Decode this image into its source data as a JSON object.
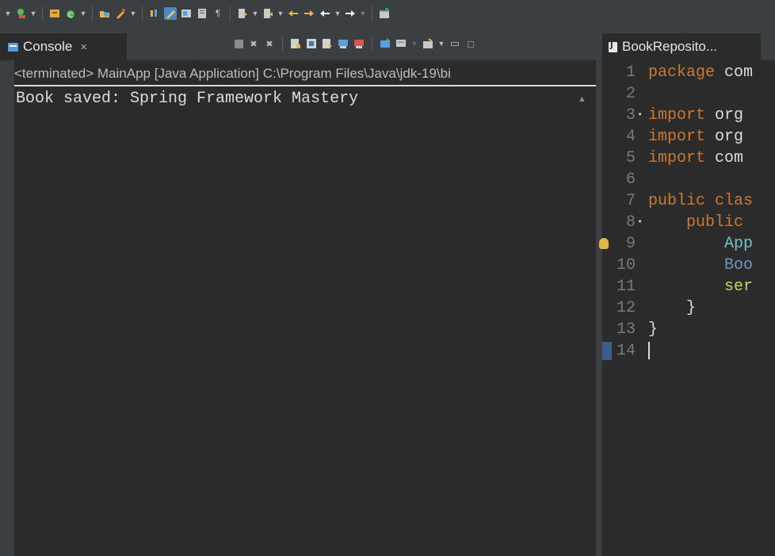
{
  "toolbar": {
    "icons": [
      "run-icon",
      "dropdown-icon",
      "new-package-icon",
      "new-class-icon",
      "open-type-icon",
      "search-icon",
      "annotation-icon",
      "mark-occurrences-icon",
      "show-whitespace-icon",
      "next-annotation-icon",
      "prev-annotation-icon",
      "last-edit-icon",
      "back-icon",
      "forward-icon",
      "new-window-icon"
    ]
  },
  "console": {
    "tab_label": "Console",
    "close_glyph": "×",
    "status": "<terminated> MainApp [Java Application] C:\\Program Files\\Java\\jdk-19\\bi",
    "output": "Book saved: Spring Framework Mastery",
    "scroll_up_glyph": "▲"
  },
  "editor": {
    "tab_label": "BookReposito...",
    "lines": [
      {
        "n": "1",
        "segments": [
          {
            "t": "package",
            "c": "kw"
          },
          {
            "t": " com",
            "c": ""
          }
        ]
      },
      {
        "n": "2",
        "segments": []
      },
      {
        "n": "3",
        "marker": "•",
        "segments": [
          {
            "t": "import",
            "c": "kw"
          },
          {
            "t": " org",
            "c": ""
          }
        ]
      },
      {
        "n": "4",
        "segments": [
          {
            "t": "import",
            "c": "kw"
          },
          {
            "t": " org",
            "c": ""
          }
        ]
      },
      {
        "n": "5",
        "segments": [
          {
            "t": "import",
            "c": "kw"
          },
          {
            "t": " com",
            "c": ""
          }
        ]
      },
      {
        "n": "6",
        "segments": []
      },
      {
        "n": "7",
        "segments": [
          {
            "t": "public",
            "c": "kw"
          },
          {
            "t": " ",
            "c": ""
          },
          {
            "t": "clas",
            "c": "kw"
          }
        ]
      },
      {
        "n": "8",
        "marker": "•",
        "segments": [
          {
            "t": "    ",
            "c": ""
          },
          {
            "t": "public",
            "c": "kw"
          }
        ]
      },
      {
        "n": "9",
        "bulb": true,
        "segments": [
          {
            "t": "        ",
            "c": ""
          },
          {
            "t": "App",
            "c": "cls"
          }
        ]
      },
      {
        "n": "10",
        "segments": [
          {
            "t": "        ",
            "c": ""
          },
          {
            "t": "Boo",
            "c": "fld"
          }
        ]
      },
      {
        "n": "11",
        "segments": [
          {
            "t": "        ",
            "c": ""
          },
          {
            "t": "ser",
            "c": "var"
          }
        ]
      },
      {
        "n": "12",
        "segments": [
          {
            "t": "    }",
            "c": ""
          }
        ]
      },
      {
        "n": "13",
        "segments": [
          {
            "t": "}",
            "c": ""
          }
        ]
      },
      {
        "n": "14",
        "current": true,
        "segments": []
      }
    ]
  }
}
